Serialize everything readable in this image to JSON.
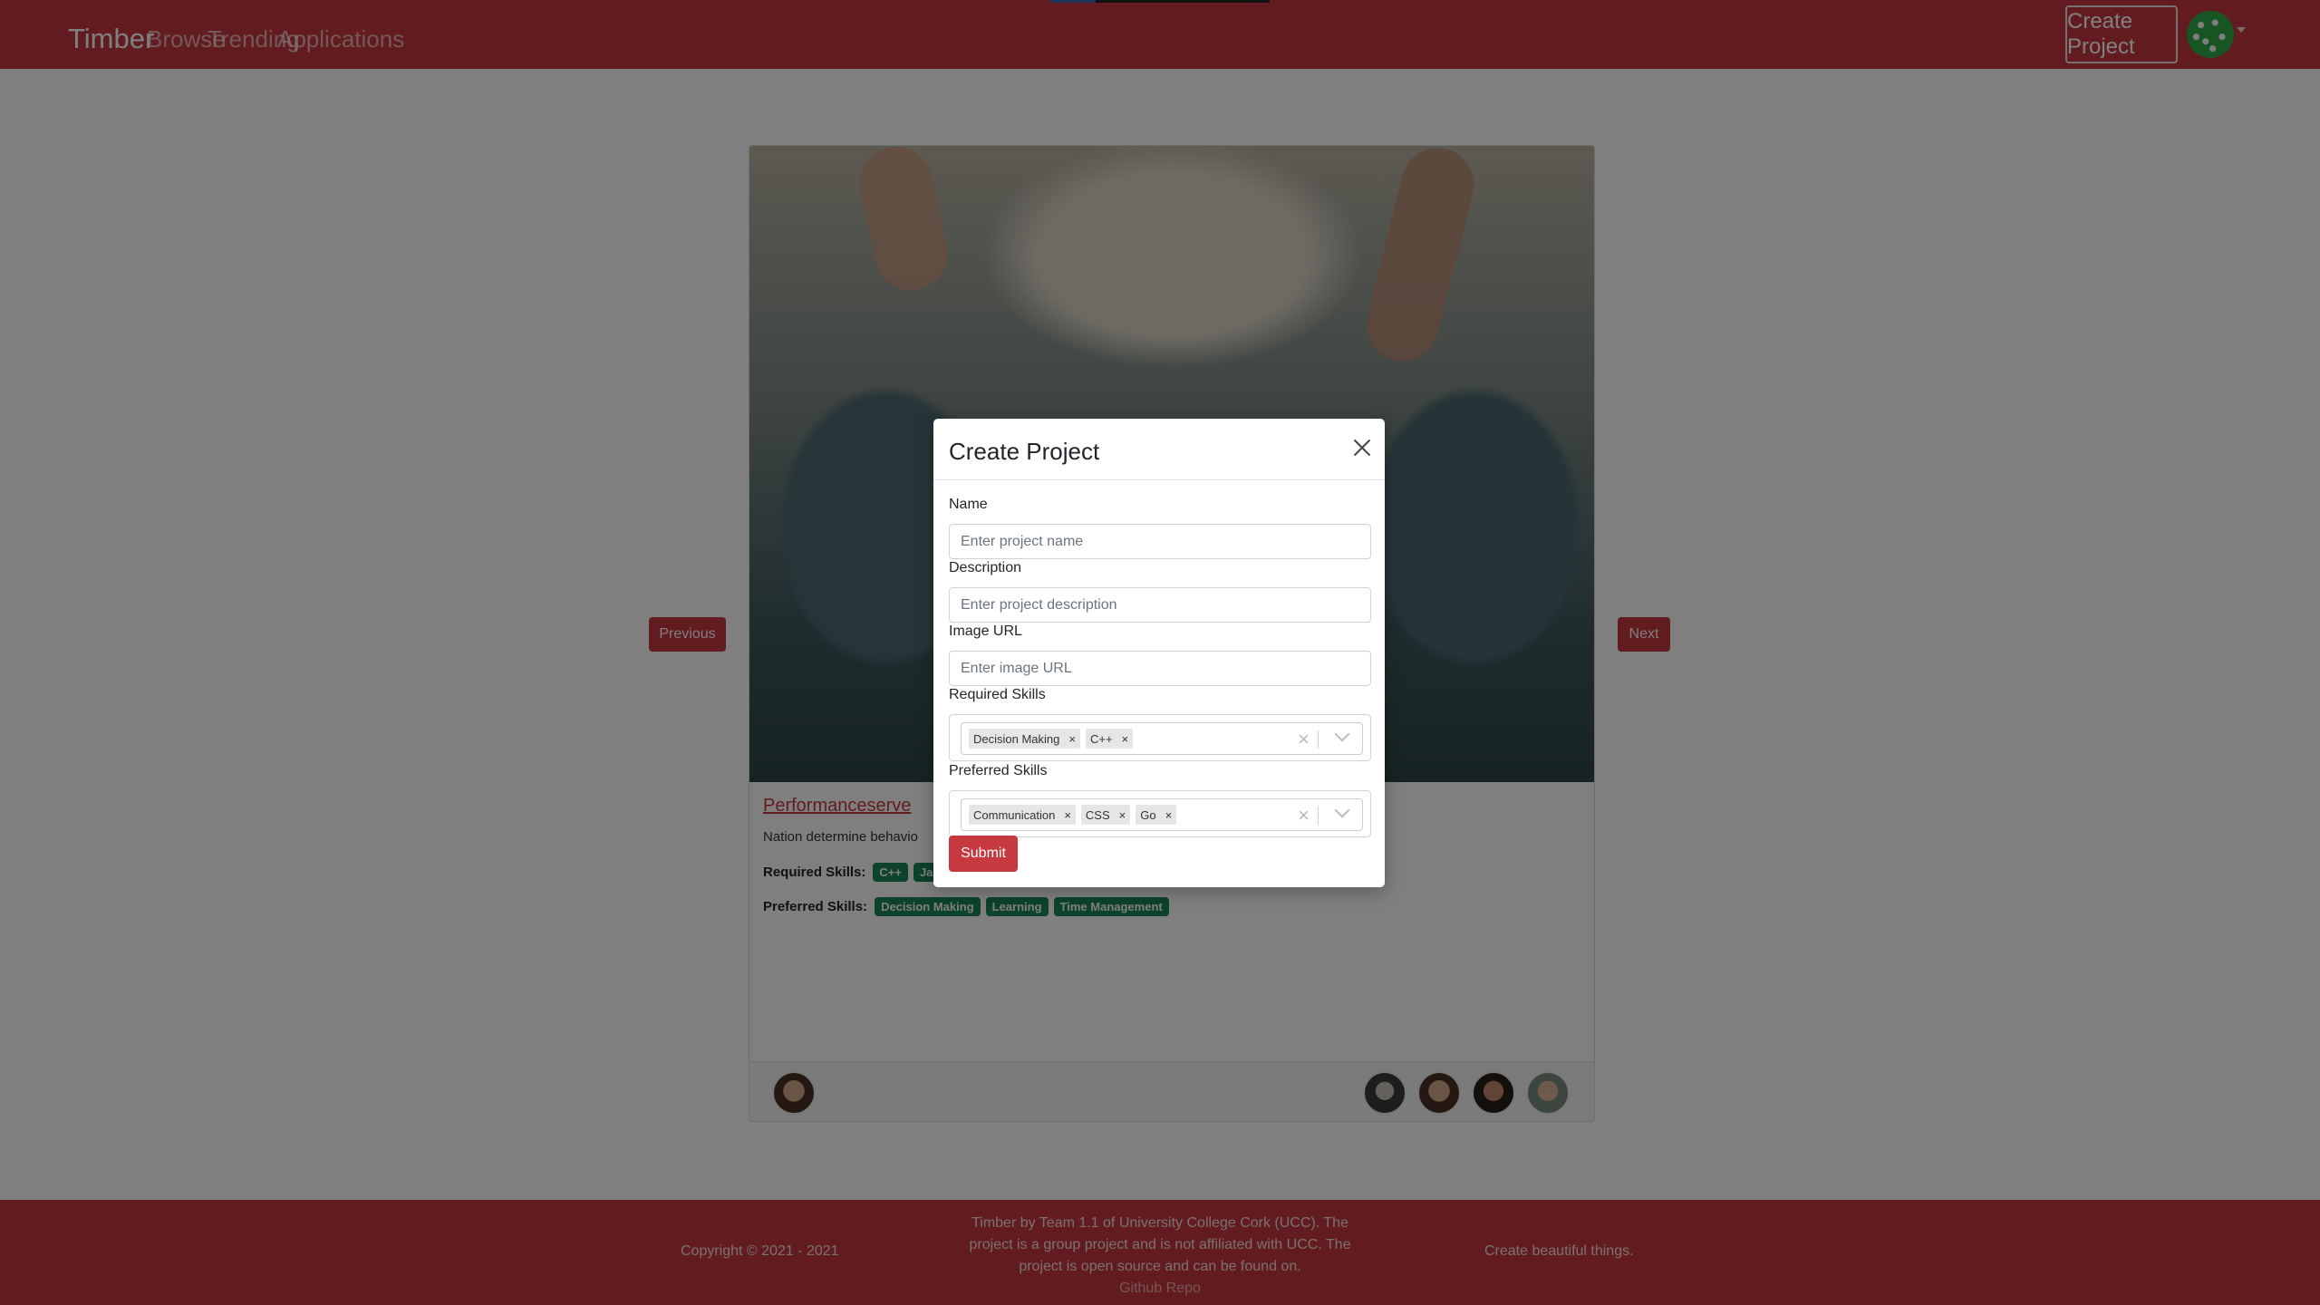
{
  "navbar": {
    "brand": "Timber",
    "links": [
      "Browse",
      "Trending",
      "Applications"
    ],
    "create_button": "Create Project",
    "avatar_icon": "user-avatar-icon"
  },
  "project": {
    "title": "Performanceserve",
    "description": "Nation determine behavio",
    "required_label": "Required Skills:",
    "required_skills": [
      "C++",
      "Ja"
    ],
    "preferred_label": "Preferred Skills:",
    "preferred_skills": [
      "Decision Making",
      "Learning",
      "Time Management"
    ]
  },
  "carousel": {
    "previous": "Previous",
    "next": "Next"
  },
  "footer": {
    "copyright": "Copyright © 2021 - 2021",
    "blurb": "Timber by Team 1.1 of University College Cork (UCC). The project is a group project and is not affiliated with UCC. The project is open source and can be found on.",
    "repo_link": "Github Repo",
    "tagline": "Create beautiful things."
  },
  "modal": {
    "title": "Create Project",
    "name_label": "Name",
    "name_placeholder": "Enter project name",
    "description_label": "Description",
    "description_placeholder": "Enter project description",
    "image_label": "Image URL",
    "image_placeholder": "Enter image URL",
    "required_label": "Required Skills",
    "required_selected": [
      "Decision Making",
      "C++"
    ],
    "preferred_label": "Preferred Skills",
    "preferred_selected": [
      "Communication",
      "CSS",
      "Go"
    ],
    "submit": "Submit",
    "chip_remove": "×",
    "clear_symbol": "×"
  },
  "colors": {
    "brand": "#c5393f",
    "skill_tag": "#198754"
  }
}
